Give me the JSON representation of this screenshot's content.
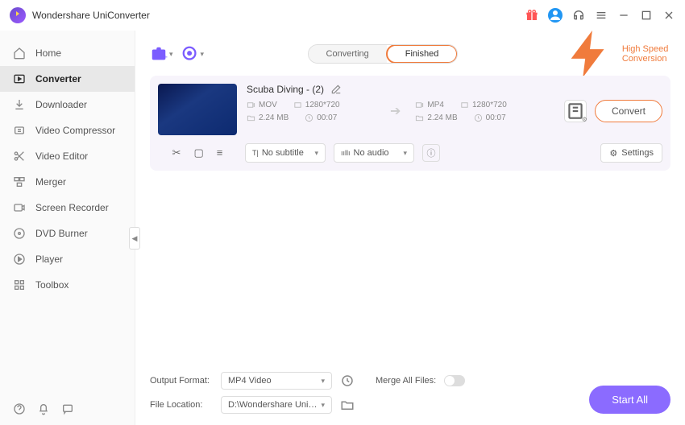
{
  "app": {
    "title": "Wondershare UniConverter"
  },
  "sidebar": {
    "items": [
      {
        "label": "Home"
      },
      {
        "label": "Converter"
      },
      {
        "label": "Downloader"
      },
      {
        "label": "Video Compressor"
      },
      {
        "label": "Video Editor"
      },
      {
        "label": "Merger"
      },
      {
        "label": "Screen Recorder"
      },
      {
        "label": "DVD Burner"
      },
      {
        "label": "Player"
      },
      {
        "label": "Toolbox"
      }
    ]
  },
  "tabs": {
    "converting": "Converting",
    "finished": "Finished"
  },
  "topbar": {
    "high_speed": "High Speed Conversion"
  },
  "file": {
    "title": "Scuba Diving - (2)",
    "src": {
      "format": "MOV",
      "resolution": "1280*720",
      "size": "2.24 MB",
      "duration": "00:07"
    },
    "dst": {
      "format": "MP4",
      "resolution": "1280*720",
      "size": "2.24 MB",
      "duration": "00:07"
    },
    "convert_label": "Convert",
    "subtitle": "No subtitle",
    "audio": "No audio",
    "settings_label": "Settings"
  },
  "footer": {
    "output_format_label": "Output Format:",
    "output_format_value": "MP4 Video",
    "file_location_label": "File Location:",
    "file_location_value": "D:\\Wondershare UniConverter",
    "merge_label": "Merge All Files:",
    "start_all": "Start All"
  }
}
